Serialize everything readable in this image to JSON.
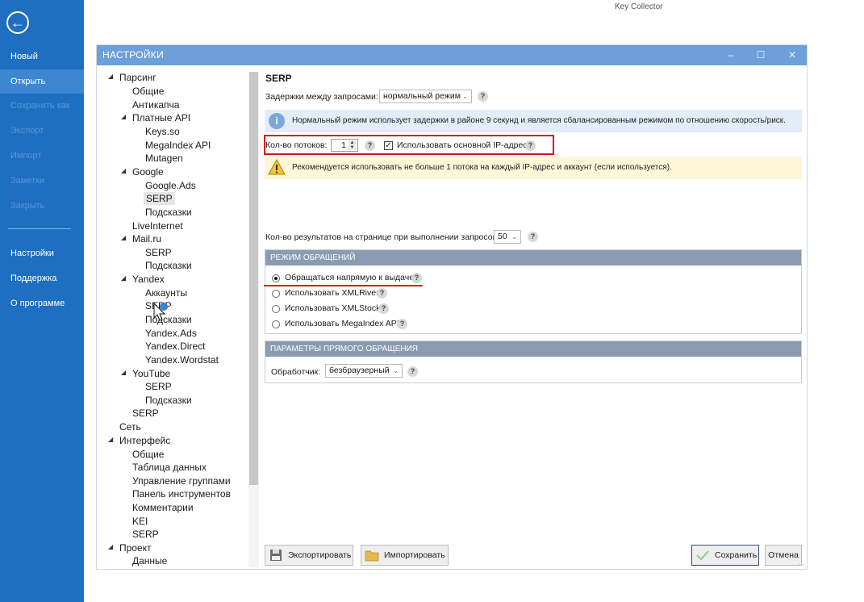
{
  "app": {
    "title": "Key Collector"
  },
  "backstage": {
    "back_icon": "arrow-left-circle-icon",
    "items": [
      {
        "label": "Новый"
      },
      {
        "label": "Открыть"
      },
      {
        "label": "Сохранить как"
      },
      {
        "label": "Экспорт"
      },
      {
        "label": "Импорт"
      },
      {
        "label": "Заметки"
      },
      {
        "label": "Закрыть"
      },
      {
        "label": "Настройки"
      },
      {
        "label": "Поддержка"
      },
      {
        "label": "О программе"
      }
    ]
  },
  "dialog": {
    "title": "НАСТРОЙКИ",
    "controls": {
      "minimize": "–",
      "maximize": "☐",
      "close": "✕"
    }
  },
  "tree": {
    "items": [
      {
        "label": "Парсинг"
      },
      {
        "label": "Общие"
      },
      {
        "label": "Антикапча"
      },
      {
        "label": "Платные API"
      },
      {
        "label": "Keys.so"
      },
      {
        "label": "MegaIndex API"
      },
      {
        "label": "Mutagen"
      },
      {
        "label": "Google"
      },
      {
        "label": "Google.Ads"
      },
      {
        "label": "SERP"
      },
      {
        "label": "Подсказки"
      },
      {
        "label": "LiveInternet"
      },
      {
        "label": "Mail.ru"
      },
      {
        "label": "SERP"
      },
      {
        "label": "Подсказки"
      },
      {
        "label": "Yandex"
      },
      {
        "label": "Аккаунты"
      },
      {
        "label": "SERP"
      },
      {
        "label": "Подсказки"
      },
      {
        "label": "Yandex.Ads"
      },
      {
        "label": "Yandex.Direct"
      },
      {
        "label": "Yandex.Wordstat"
      },
      {
        "label": "YouTube"
      },
      {
        "label": "SERP"
      },
      {
        "label": "Подсказки"
      },
      {
        "label": "SERP"
      },
      {
        "label": "Сеть"
      },
      {
        "label": "Интерфейс"
      },
      {
        "label": "Общие"
      },
      {
        "label": "Таблица данных"
      },
      {
        "label": "Управление группами"
      },
      {
        "label": "Панель инструментов"
      },
      {
        "label": "Комментарии"
      },
      {
        "label": "KEI"
      },
      {
        "label": "SERP"
      },
      {
        "label": "Проект"
      },
      {
        "label": "Данные"
      }
    ]
  },
  "panel": {
    "heading": "SERP",
    "delay": {
      "label": "Задержки между запросами:",
      "value": "нормальный режим"
    },
    "info_text": "Нормальный режим использует задержки в районе 9 секунд и является сбалансированным режимом по отношению скорость/риск.",
    "threads": {
      "label": "Кол-во потоков:",
      "value": "1",
      "use_ip_label": "Использовать основной IP-адрес",
      "use_ip_checked": true
    },
    "warning_text": "Рекомендуется использовать не больше 1 потока на каждый IP-адрес и аккаунт (если используется).",
    "results": {
      "label": "Кол-во результатов на странице при выполнении запросов:",
      "value": "50"
    },
    "mode_section": {
      "header": "РЕЖИМ ОБРАЩЕНИЙ",
      "options": [
        {
          "label": "Обращаться напрямую к выдаче",
          "checked": true
        },
        {
          "label": "Использовать XMLRiver",
          "checked": false
        },
        {
          "label": "Использовать XMLStock",
          "checked": false
        },
        {
          "label": "Использовать MegaIndex API",
          "checked": false
        }
      ]
    },
    "direct_section": {
      "header": "ПАРАМЕТРЫ ПРЯМОГО ОБРАЩЕНИЯ",
      "handler_label": "Обработчик:",
      "handler_value": "безбраузерный"
    },
    "help_glyph": "?"
  },
  "footer": {
    "export_label": "Экспортировать",
    "import_label": "Импортировать",
    "save_label": "Сохранить",
    "cancel_label": "Отмена"
  },
  "colors": {
    "backstage": "#1e6fc2",
    "titlebar": "#6d9fdb",
    "section_header": "#8a9bb2",
    "highlight": "#e0141e"
  }
}
